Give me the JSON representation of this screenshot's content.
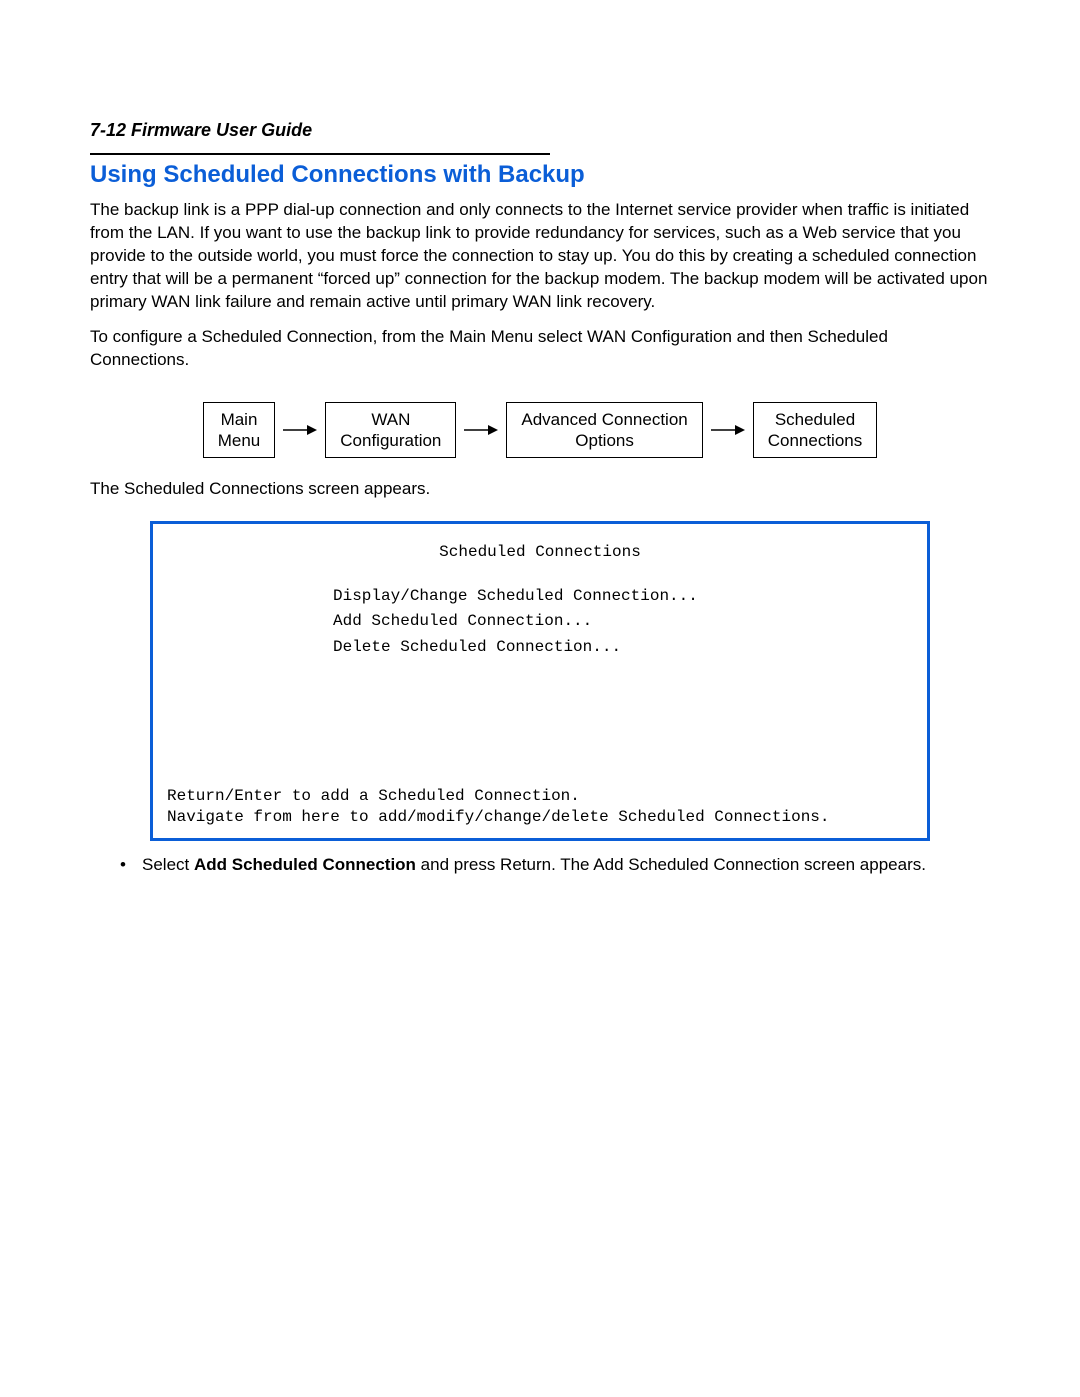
{
  "header": {
    "page_label": "7-12  Firmware User Guide"
  },
  "section": {
    "title": "Using Scheduled Connections with Backup",
    "paragraph1": "The backup link is a PPP dial-up connection and only connects to the Internet service provider when traffic is initiated from the LAN. If you want to use the backup link to provide redundancy for services, such as a Web service that you provide to the outside world, you must force the connection to stay up. You do this by creating a scheduled connection entry that will be a permanent “forced up” connection for the backup modem. The backup modem will be activated upon primary WAN link failure and remain active until primary WAN link recovery.",
    "paragraph2": "To configure a Scheduled Connection, from the Main Menu select WAN Configuration and then Scheduled Connections."
  },
  "nav": {
    "box1": "Main\nMenu",
    "box2": "WAN\nConfiguration",
    "box3": "Advanced Connection\nOptions",
    "box4": "Scheduled\nConnections"
  },
  "after_nav": "The Scheduled Connections screen appears.",
  "terminal": {
    "title": "Scheduled Connections",
    "menu1": "Display/Change Scheduled Connection...",
    "menu2": "Add Scheduled Connection...",
    "menu3": "Delete Scheduled Connection...",
    "footer1": "Return/Enter to add a Scheduled Connection.",
    "footer2": "Navigate from here to add/modify/change/delete Scheduled Connections."
  },
  "bullet": {
    "dot": "•",
    "prefix": "Select ",
    "strong": "Add Scheduled Connection",
    "suffix": " and press Return. The Add Scheduled Connection screen appears."
  }
}
